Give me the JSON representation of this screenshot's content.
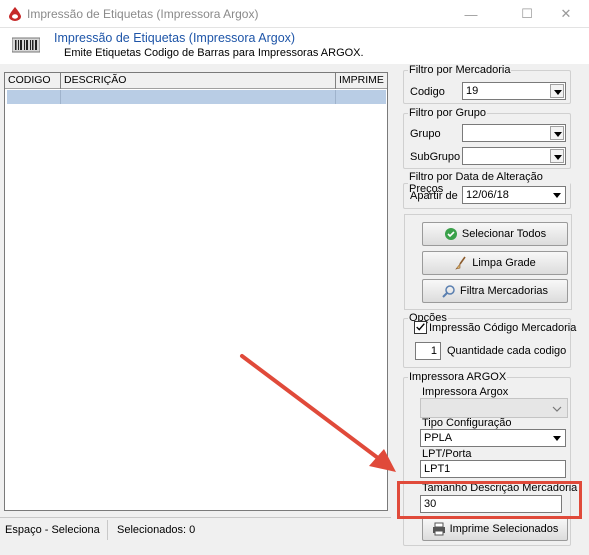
{
  "window": {
    "title": "Impressão de Etiquetas (Impressora Argox)",
    "minimize": "—",
    "maximize": "☐",
    "close": "✕"
  },
  "header": {
    "title": "Impressão de Etiquetas (Impressora Argox)",
    "subtitle": "Emite Etiquetas Codigo de Barras para Impressoras ARGOX."
  },
  "grid": {
    "columns": [
      "CODIGO",
      "DESCRIÇÃO",
      "IMPRIME ?"
    ]
  },
  "status": {
    "left": "Espaço - Seleciona",
    "right": "Selecionados: 0"
  },
  "filtro_mercadoria": {
    "legend": "Filtro por Mercadoria",
    "codigo_label": "Codigo",
    "codigo_value": "19"
  },
  "filtro_grupo": {
    "legend": "Filtro por Grupo",
    "grupo_label": "Grupo",
    "grupo_value": "",
    "subgrupo_label": "SubGrupo",
    "subgrupo_value": ""
  },
  "filtro_data": {
    "legend": "Filtro por Data de Alteração Preços",
    "apartir_label": "Apartir de",
    "apartir_value": "12/06/18"
  },
  "actions": {
    "selecionar_todos": "Selecionar Todos",
    "limpa_grade": "Limpa Grade",
    "filtra_mercadorias": "Filtra Mercadorias"
  },
  "opcoes": {
    "legend": "Opções",
    "impressao_codigo": "Impressão Código Mercadoria",
    "impressao_codigo_checked": true,
    "quantidade_value": "1",
    "quantidade_label": "Quantidade cada codigo"
  },
  "argox": {
    "legend": "Impressora ARGOX",
    "impressora_label": "Impressora Argox",
    "impressora_value": "",
    "tipo_label": "Tipo Configuração",
    "tipo_value": "PPLA",
    "porta_label": "LPT/Porta",
    "porta_value": "LPT1",
    "tamanho_label": "Tamanho Descrição Mercadoria",
    "tamanho_value": "30",
    "imprime_button": "Imprime Selecionados"
  },
  "colors": {
    "accent_title": "#1e55a8",
    "row_selected": "#b9cde5",
    "annotation": "#e04a3a"
  }
}
